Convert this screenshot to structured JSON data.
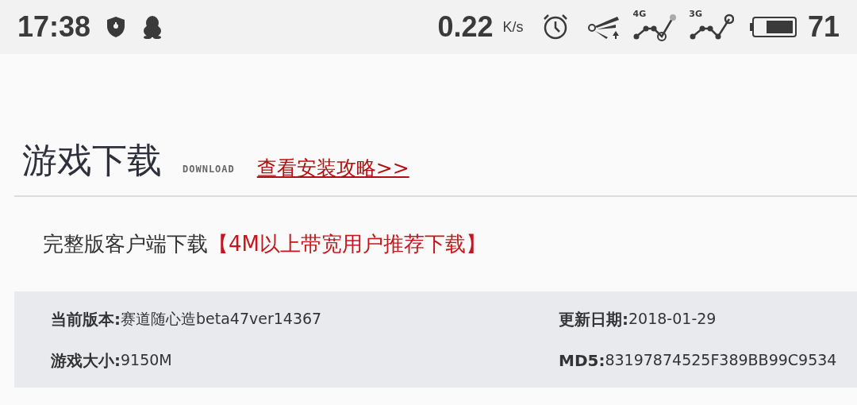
{
  "status_bar": {
    "time": "17:38",
    "speed": "0.22",
    "speed_unit": "K/s",
    "battery": "71",
    "networks": [
      "4G",
      "3G"
    ]
  },
  "header": {
    "title": "游戏下载",
    "subtitle": "DOWNLOAD",
    "link": "查看安装攻略>>"
  },
  "section": {
    "title": "完整版客户端下载",
    "highlight": "【4M以上带宽用户推荐下载】"
  },
  "info": [
    {
      "label": "当前版本:",
      "value": " 赛道随心造beta47ver14367"
    },
    {
      "label": "更新日期:",
      "value": "2018-01-29"
    },
    {
      "label": "游戏大小:",
      "value": "9150M"
    },
    {
      "label": "MD5:",
      "value": "83197874525F389BB99C9534"
    }
  ]
}
